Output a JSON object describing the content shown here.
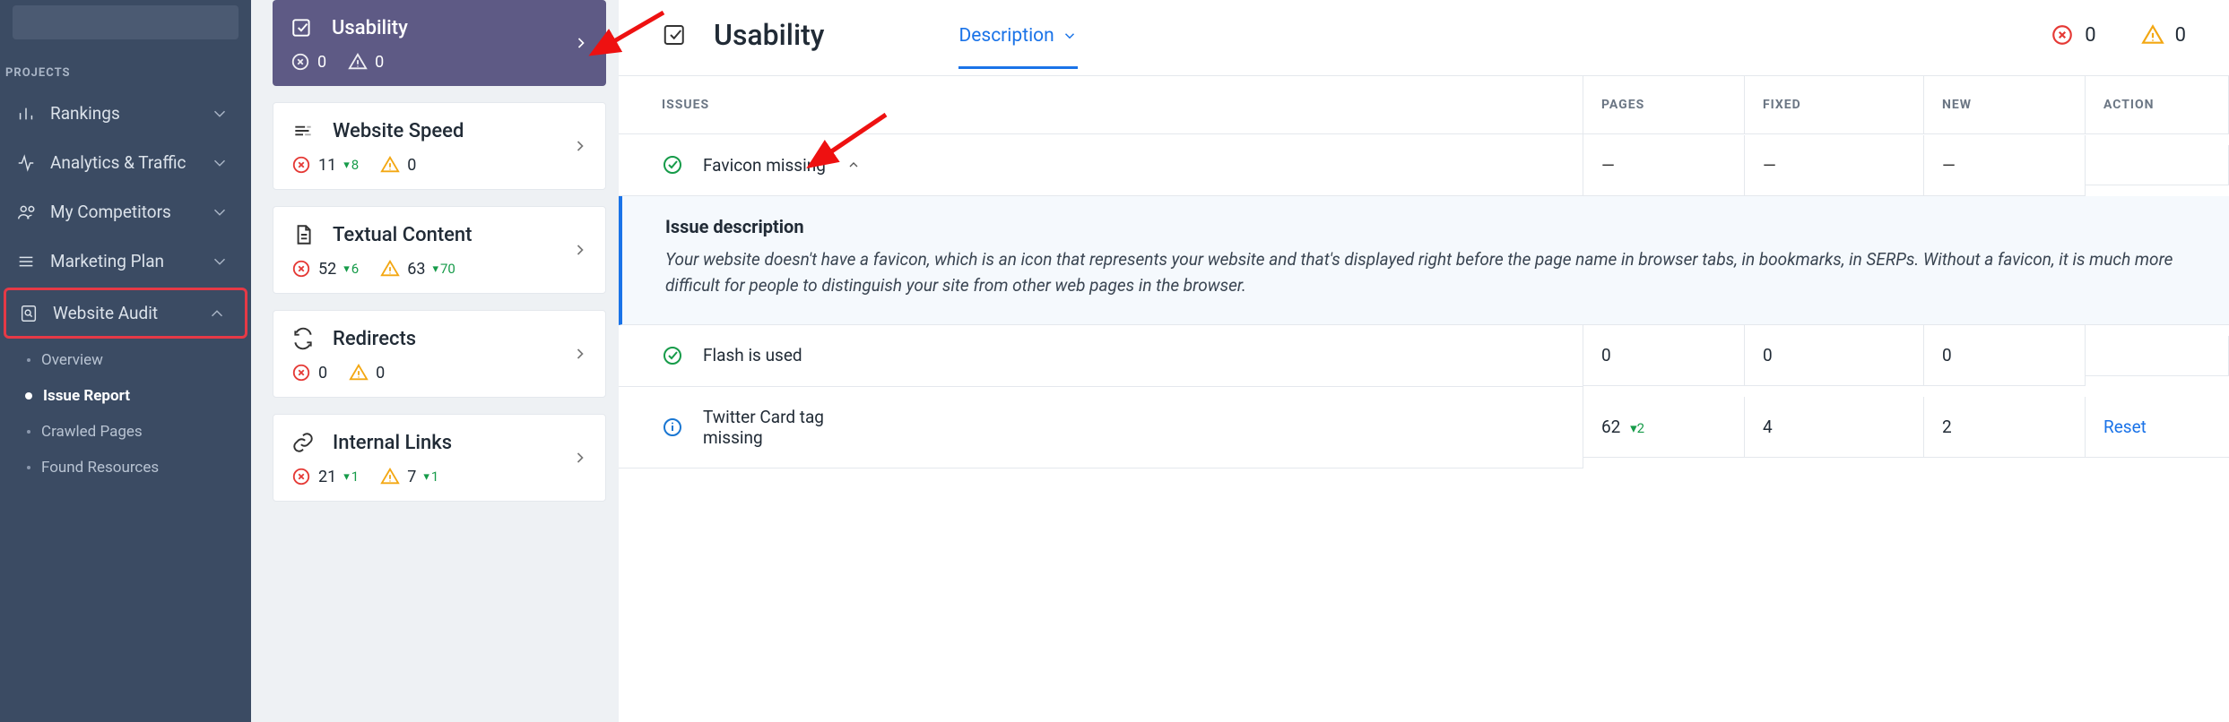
{
  "sidebar": {
    "section_title": "PROJECTS",
    "items": [
      {
        "label": "Rankings"
      },
      {
        "label": "Analytics & Traffic"
      },
      {
        "label": "My Competitors"
      },
      {
        "label": "Marketing Plan"
      },
      {
        "label": "Website Audit"
      }
    ],
    "audit_sub": [
      {
        "label": "Overview"
      },
      {
        "label": "Issue Report"
      },
      {
        "label": "Crawled Pages"
      },
      {
        "label": "Found Resources"
      }
    ]
  },
  "cards": [
    {
      "title": "Usability",
      "errors": "0",
      "warnings": "0"
    },
    {
      "title": "Website Speed",
      "errors": "11",
      "errors_delta": "8",
      "warnings": "0"
    },
    {
      "title": "Textual Content",
      "errors": "52",
      "errors_delta": "6",
      "warnings": "63",
      "warnings_delta": "70"
    },
    {
      "title": "Redirects",
      "errors": "0",
      "warnings": "0"
    },
    {
      "title": "Internal Links",
      "errors": "21",
      "errors_delta": "1",
      "warnings": "7",
      "warnings_delta": "1"
    }
  ],
  "main": {
    "title": "Usability",
    "tab_label": "Description",
    "header_errors": "0",
    "header_warnings": "0",
    "columns": {
      "issues": "Issues",
      "pages": "Pages",
      "fixed": "Fixed",
      "new": "New",
      "action": "Action"
    },
    "rows": [
      {
        "name": "Favicon missing",
        "pages": "—",
        "fixed": "—",
        "new": "—",
        "action": "",
        "expanded": true,
        "desc_title": "Issue description",
        "desc_body": "Your website doesn't have a favicon, which is an icon that represents your website and that's displayed right before the page name in browser tabs, in bookmarks, in SERPs. Without a favicon, it is much more difficult for people to distinguish your site from other web pages in the browser."
      },
      {
        "name": "Flash is used",
        "pages": "0",
        "fixed": "0",
        "new": "0",
        "action": ""
      },
      {
        "name": "Twitter Card tag missing",
        "pages": "62",
        "pages_delta": "2",
        "fixed": "4",
        "new": "2",
        "action": "Reset"
      }
    ]
  }
}
